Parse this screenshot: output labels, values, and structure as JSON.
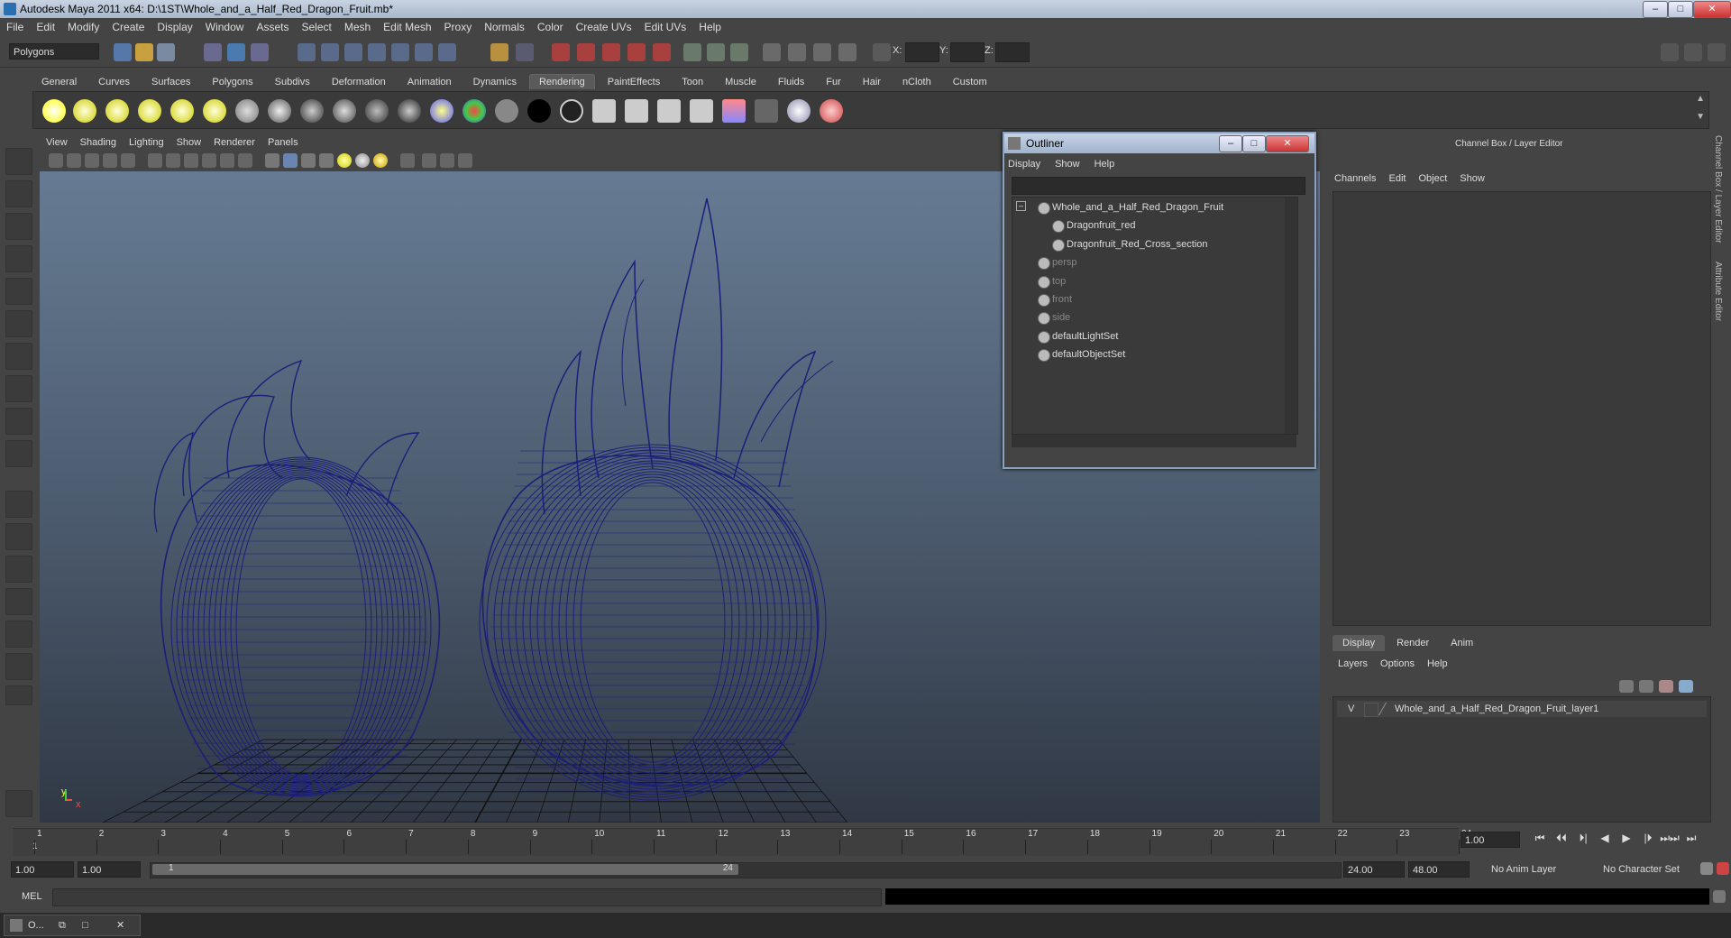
{
  "window": {
    "title": "Autodesk Maya 2011 x64: D:\\1ST\\Whole_and_a_Half_Red_Dragon_Fruit.mb*",
    "min": "–",
    "max": "□",
    "close": "✕"
  },
  "menubar": [
    "File",
    "Edit",
    "Modify",
    "Create",
    "Display",
    "Window",
    "Assets",
    "Select",
    "Mesh",
    "Edit Mesh",
    "Proxy",
    "Normals",
    "Color",
    "Create UVs",
    "Edit UVs",
    "Help"
  ],
  "statusline": {
    "mode": "Polygons",
    "x_label": "X:",
    "y_label": "Y:",
    "z_label": "Z:"
  },
  "shelf": {
    "tabs": [
      "General",
      "Curves",
      "Surfaces",
      "Polygons",
      "Subdivs",
      "Deformation",
      "Animation",
      "Dynamics",
      "Rendering",
      "PaintEffects",
      "Toon",
      "Muscle",
      "Fluids",
      "Fur",
      "Hair",
      "nCloth",
      "Custom"
    ],
    "active_tab": "Rendering"
  },
  "viewport": {
    "menu": [
      "View",
      "Shading",
      "Lighting",
      "Show",
      "Renderer",
      "Panels"
    ],
    "axis_y": "y",
    "axis_x": "x",
    "wire_color": "#1c1e7a"
  },
  "outliner": {
    "title": "Outliner",
    "menu": [
      "Display",
      "Show",
      "Help"
    ],
    "items": [
      {
        "label": "Whole_and_a_Half_Red_Dragon_Fruit",
        "dim": false
      },
      {
        "label": "Dragonfruit_red",
        "dim": false
      },
      {
        "label": "Dragonfruit_Red_Cross_section",
        "dim": false
      },
      {
        "label": "persp",
        "dim": true
      },
      {
        "label": "top",
        "dim": true
      },
      {
        "label": "front",
        "dim": true
      },
      {
        "label": "side",
        "dim": true
      },
      {
        "label": "defaultLightSet",
        "dim": false
      },
      {
        "label": "defaultObjectSet",
        "dim": false
      }
    ]
  },
  "channelbox": {
    "title": "Channel Box / Layer Editor",
    "menu": [
      "Channels",
      "Edit",
      "Object",
      "Show"
    ],
    "layer_tabs": [
      "Display",
      "Render",
      "Anim"
    ],
    "active_layer_tab": "Display",
    "layer_menu": [
      "Layers",
      "Options",
      "Help"
    ],
    "layer": {
      "visibility": "V",
      "name": "Whole_and_a_Half_Red_Dragon_Fruit_layer1"
    },
    "side_tabs": [
      "Channel Box / Layer Editor",
      "Attribute Editor"
    ]
  },
  "timeslider": {
    "start": 1,
    "end": 24,
    "ticks": [
      "1",
      "2",
      "3",
      "4",
      "5",
      "6",
      "7",
      "8",
      "9",
      "10",
      "11",
      "12",
      "13",
      "14",
      "15",
      "16",
      "17",
      "18",
      "19",
      "20",
      "21",
      "22",
      "23",
      "24"
    ],
    "current_frame_label": "1",
    "current_frame_field": "1.00"
  },
  "playback": {
    "buttons": [
      "⏮",
      "⏴⏴",
      "⏵|",
      "◀",
      "▶",
      "|⏵",
      "⏭⏭",
      "⏭"
    ]
  },
  "range": {
    "start_field": "1.00",
    "anim_start": "1.00",
    "thumb_start": "1",
    "thumb_end": "24",
    "end_field": "24.00",
    "anim_end": "48.00",
    "anim_layer": "No Anim Layer",
    "char_set": "No Character Set"
  },
  "cmdline": {
    "label": "MEL"
  },
  "taskbar": {
    "item": "O..."
  }
}
